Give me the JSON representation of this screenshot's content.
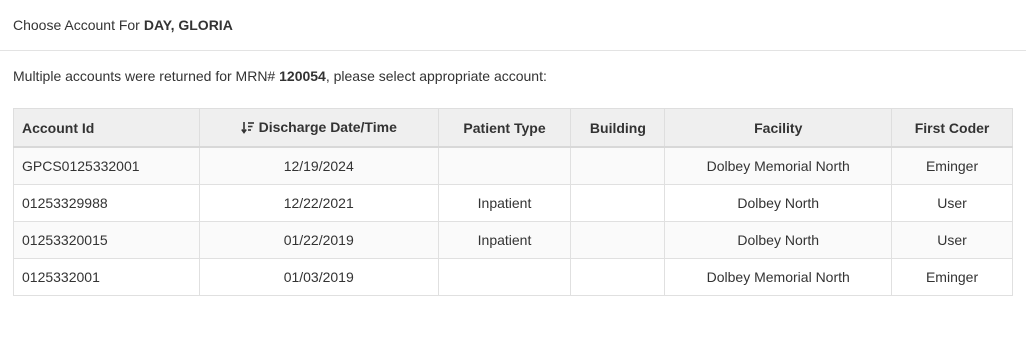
{
  "header": {
    "prefix": "Choose Account For",
    "patient_name": "DAY, GLORIA"
  },
  "message": {
    "prefix": "Multiple accounts were returned for MRN#",
    "mrn": "120054",
    "suffix": ", please select appropriate account:"
  },
  "table": {
    "columns": {
      "account_id": "Account Id",
      "discharge": "Discharge Date/Time",
      "patient_type": "Patient Type",
      "building": "Building",
      "facility": "Facility",
      "first_coder": "First Coder"
    },
    "sort_icon": "sort-descending-icon",
    "rows": [
      {
        "account_id": "GPCS0125332001",
        "discharge": "12/19/2024",
        "patient_type": "",
        "building": "",
        "facility": "Dolbey Memorial North",
        "first_coder": "Eminger"
      },
      {
        "account_id": "01253329988",
        "discharge": "12/22/2021",
        "patient_type": "Inpatient",
        "building": "",
        "facility": "Dolbey North",
        "first_coder": "User"
      },
      {
        "account_id": "01253320015",
        "discharge": "01/22/2019",
        "patient_type": "Inpatient",
        "building": "",
        "facility": "Dolbey North",
        "first_coder": "User"
      },
      {
        "account_id": "0125332001",
        "discharge": "01/03/2019",
        "patient_type": "",
        "building": "",
        "facility": "Dolbey Memorial North",
        "first_coder": "Eminger"
      }
    ]
  }
}
